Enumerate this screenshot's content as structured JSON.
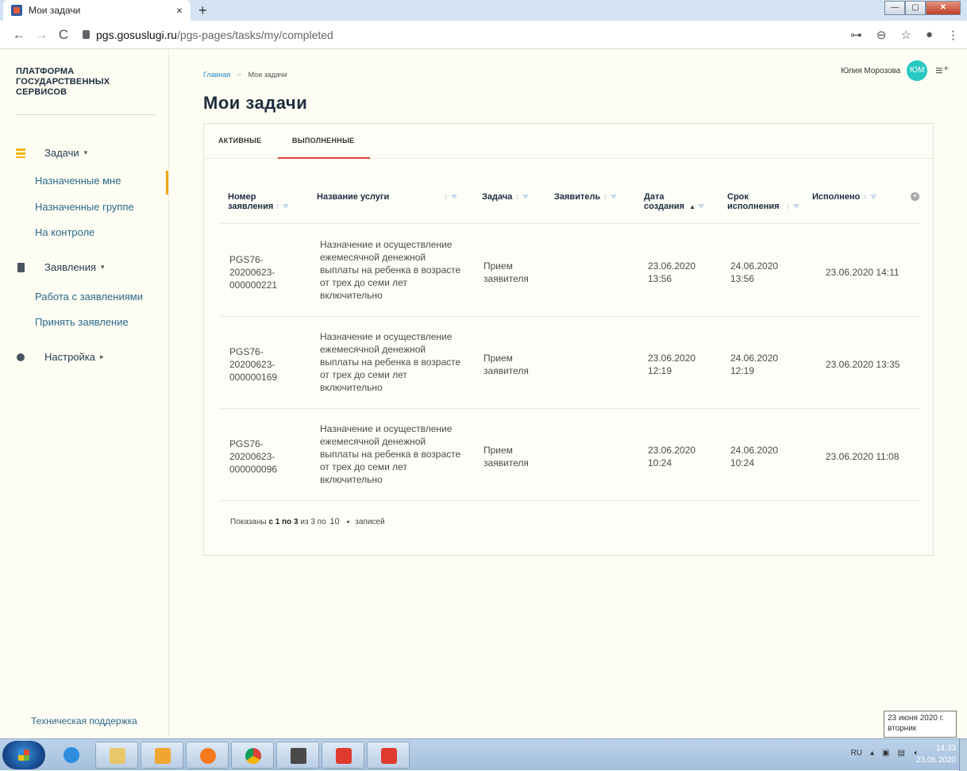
{
  "browser": {
    "tab_title": "Мои задачи",
    "tab_close": "×",
    "new_tab": "+",
    "url_host": "pgs.gosuslugi.ru",
    "url_path": "/pgs-pages/tasks/my/completed",
    "back": "←",
    "forward": "→",
    "reload": "C",
    "key_icon": "⊶",
    "zoom_icon": "⊖",
    "star_icon": "☆",
    "account_icon": "●",
    "menu_icon": "⋮",
    "min": "—",
    "max": "▢",
    "close": "✕"
  },
  "sidebar": {
    "brand": "ПЛАТФОРМА ГОСУДАРСТВЕННЫХ СЕРВИСОВ",
    "groups": [
      {
        "label": "Задачи",
        "caret": "▾",
        "icon": "tasks-icon"
      },
      {
        "label": "Заявления",
        "caret": "▾",
        "icon": "clipboard-icon"
      },
      {
        "label": "Настройка",
        "caret": "▸",
        "icon": "gear-icon"
      }
    ],
    "task_items": [
      "Назначенные мне",
      "Назначенные группе",
      "На контроле"
    ],
    "application_items": [
      "Работа с заявлениями",
      "Принять заявление"
    ],
    "support": "Техническая поддержка"
  },
  "header": {
    "breadcrumb_home": "Главная",
    "breadcrumb_sep": ">",
    "breadcrumb_current": "Мои задачи",
    "title": "Мои задачи",
    "user_name": "Юлия Морозова",
    "user_initials": "ЮМ",
    "menu_icon": "≡⁺"
  },
  "tabs": [
    "АКТИВНЫЕ",
    "ВЫПОЛНЕННЫЕ"
  ],
  "columns": [
    {
      "label": "Номер заявления"
    },
    {
      "label": "Название услуги"
    },
    {
      "label": "Задача"
    },
    {
      "label": "Заявитель"
    },
    {
      "label": "Дата создания"
    },
    {
      "label": "Срок исполнения"
    },
    {
      "label": "Исполнено"
    }
  ],
  "rows": [
    {
      "number": "PGS76-20200623-000000221",
      "service": "Назначение и осуществление ежемесячной денежной выплаты на ребенка в возрасте от трех до семи лет включительно",
      "task": "Прием заявителя",
      "applicant": "",
      "created": "23.06.2020 13:56",
      "deadline": "24.06.2020 13:56",
      "done": "23.06.2020 14:11"
    },
    {
      "number": "PGS76-20200623-000000169",
      "service": "Назначение и осуществление ежемесячной денежной выплаты на ребенка в возрасте от трех до семи лет включительно",
      "task": "Прием заявителя",
      "applicant": "",
      "created": "23.06.2020 12:19",
      "deadline": "24.06.2020 12:19",
      "done": "23.06.2020 13:35"
    },
    {
      "number": "PGS76-20200623-000000096",
      "service": "Назначение и осуществление ежемесячной денежной выплаты на ребенка в возрасте от трех до семи лет включительно",
      "task": "Прием заявителя",
      "applicant": "",
      "created": "23.06.2020 10:24",
      "deadline": "24.06.2020 10:24",
      "done": "23.06.2020 11:08"
    }
  ],
  "footer": {
    "shown_prefix": "Показаны",
    "range": "с 1 по 3",
    "total": "из 3 по",
    "page_size": "10",
    "dropdown": "▾",
    "suffix": "записей"
  },
  "taskbar": {
    "lang": "RU",
    "time": "14:33",
    "date": "23.06.2020",
    "tooltip_line1": "23 июня 2020 г.",
    "tooltip_line2": "вторник"
  },
  "colors": {
    "accent_red": "#e3453a",
    "accent_orange": "#f0a500",
    "link_blue": "#2d6a8a",
    "avatar_teal": "#27c9c0"
  }
}
